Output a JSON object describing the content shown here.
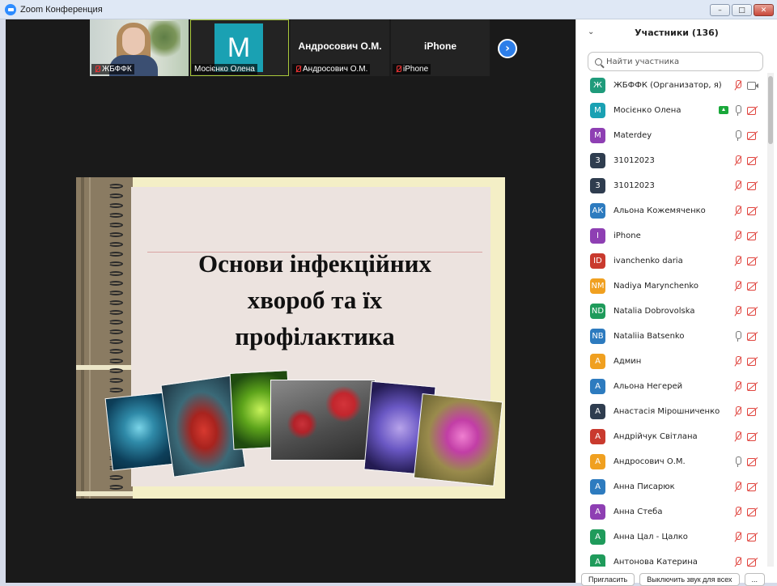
{
  "window": {
    "title": "Zoom Конференция",
    "minimize": "–",
    "maximize": "□",
    "close": "✕"
  },
  "video_strip": [
    {
      "name": "ЖБФФК",
      "type": "photo",
      "muted": true
    },
    {
      "name": "Мосієнко Олена",
      "type": "avatar",
      "initial": "M",
      "muted": false,
      "active": true
    },
    {
      "name": "Андросович О.М.",
      "type": "name",
      "muted": true
    },
    {
      "name": "iPhone",
      "type": "name",
      "muted": true
    }
  ],
  "next_arrow": "›",
  "slide": {
    "title": "Основи інфекційних хвороб та їх профілактика"
  },
  "panel": {
    "title": "Участники (136)",
    "search_placeholder": "Найти участника",
    "participants": [
      {
        "initials": "Ж",
        "name": "ЖБФФК (Организатор, я)",
        "color": "#1f9b7b",
        "mic": "off",
        "cam": "on"
      },
      {
        "initials": "M",
        "name": "Мосієнко Олена",
        "color": "#1aa1b3",
        "mic": "on",
        "cam": "off",
        "sharing": true
      },
      {
        "initials": "M",
        "name": "Materdey",
        "color": "#8e3fb3",
        "mic": "on",
        "cam": "off"
      },
      {
        "initials": "3",
        "name": "31012023",
        "color": "#2f3d4f",
        "mic": "off",
        "cam": "off"
      },
      {
        "initials": "3",
        "name": "31012023",
        "color": "#2f3d4f",
        "mic": "off",
        "cam": "off"
      },
      {
        "initials": "АК",
        "name": "Альона Кожемяченко",
        "color": "#2d7bbf",
        "mic": "off",
        "cam": "off"
      },
      {
        "initials": "I",
        "name": "iPhone",
        "color": "#8e3fb3",
        "mic": "off",
        "cam": "off"
      },
      {
        "initials": "ID",
        "name": "ivanchenko daria",
        "color": "#c93a2e",
        "mic": "off",
        "cam": "off"
      },
      {
        "initials": "NM",
        "name": "Nadiya Marynchenko",
        "color": "#f0a020",
        "mic": "off",
        "cam": "off"
      },
      {
        "initials": "ND",
        "name": "Natalia Dobrovolska",
        "color": "#1f9b5b",
        "mic": "off",
        "cam": "off"
      },
      {
        "initials": "NB",
        "name": "Nataliia Batsenko",
        "color": "#2d7bbf",
        "mic": "on",
        "cam": "off"
      },
      {
        "initials": "A",
        "name": "Админ",
        "color": "#f0a020",
        "mic": "off",
        "cam": "off"
      },
      {
        "initials": "A",
        "name": "Альона Негерей",
        "color": "#2d7bbf",
        "mic": "off",
        "cam": "off"
      },
      {
        "initials": "A",
        "name": "Анастасія Мірошниченко",
        "color": "#2f3d4f",
        "mic": "off",
        "cam": "off"
      },
      {
        "initials": "A",
        "name": "Андрійчук Світлана",
        "color": "#c93a2e",
        "mic": "off",
        "cam": "off"
      },
      {
        "initials": "A",
        "name": "Андросович О.М.",
        "color": "#f0a020",
        "mic": "on",
        "cam": "off"
      },
      {
        "initials": "A",
        "name": "Анна Писарюк",
        "color": "#2d7bbf",
        "mic": "off",
        "cam": "off"
      },
      {
        "initials": "A",
        "name": "Анна Стеба",
        "color": "#8e3fb3",
        "mic": "off",
        "cam": "off"
      },
      {
        "initials": "A",
        "name": "Анна Цал - Цалко",
        "color": "#1f9b5b",
        "mic": "off",
        "cam": "off"
      },
      {
        "initials": "A",
        "name": "Антонова Катерина",
        "color": "#1f9b5b",
        "mic": "off",
        "cam": "off"
      }
    ],
    "footer_buttons": [
      "Пригласить",
      "Выключить звук для всех",
      "..."
    ]
  }
}
